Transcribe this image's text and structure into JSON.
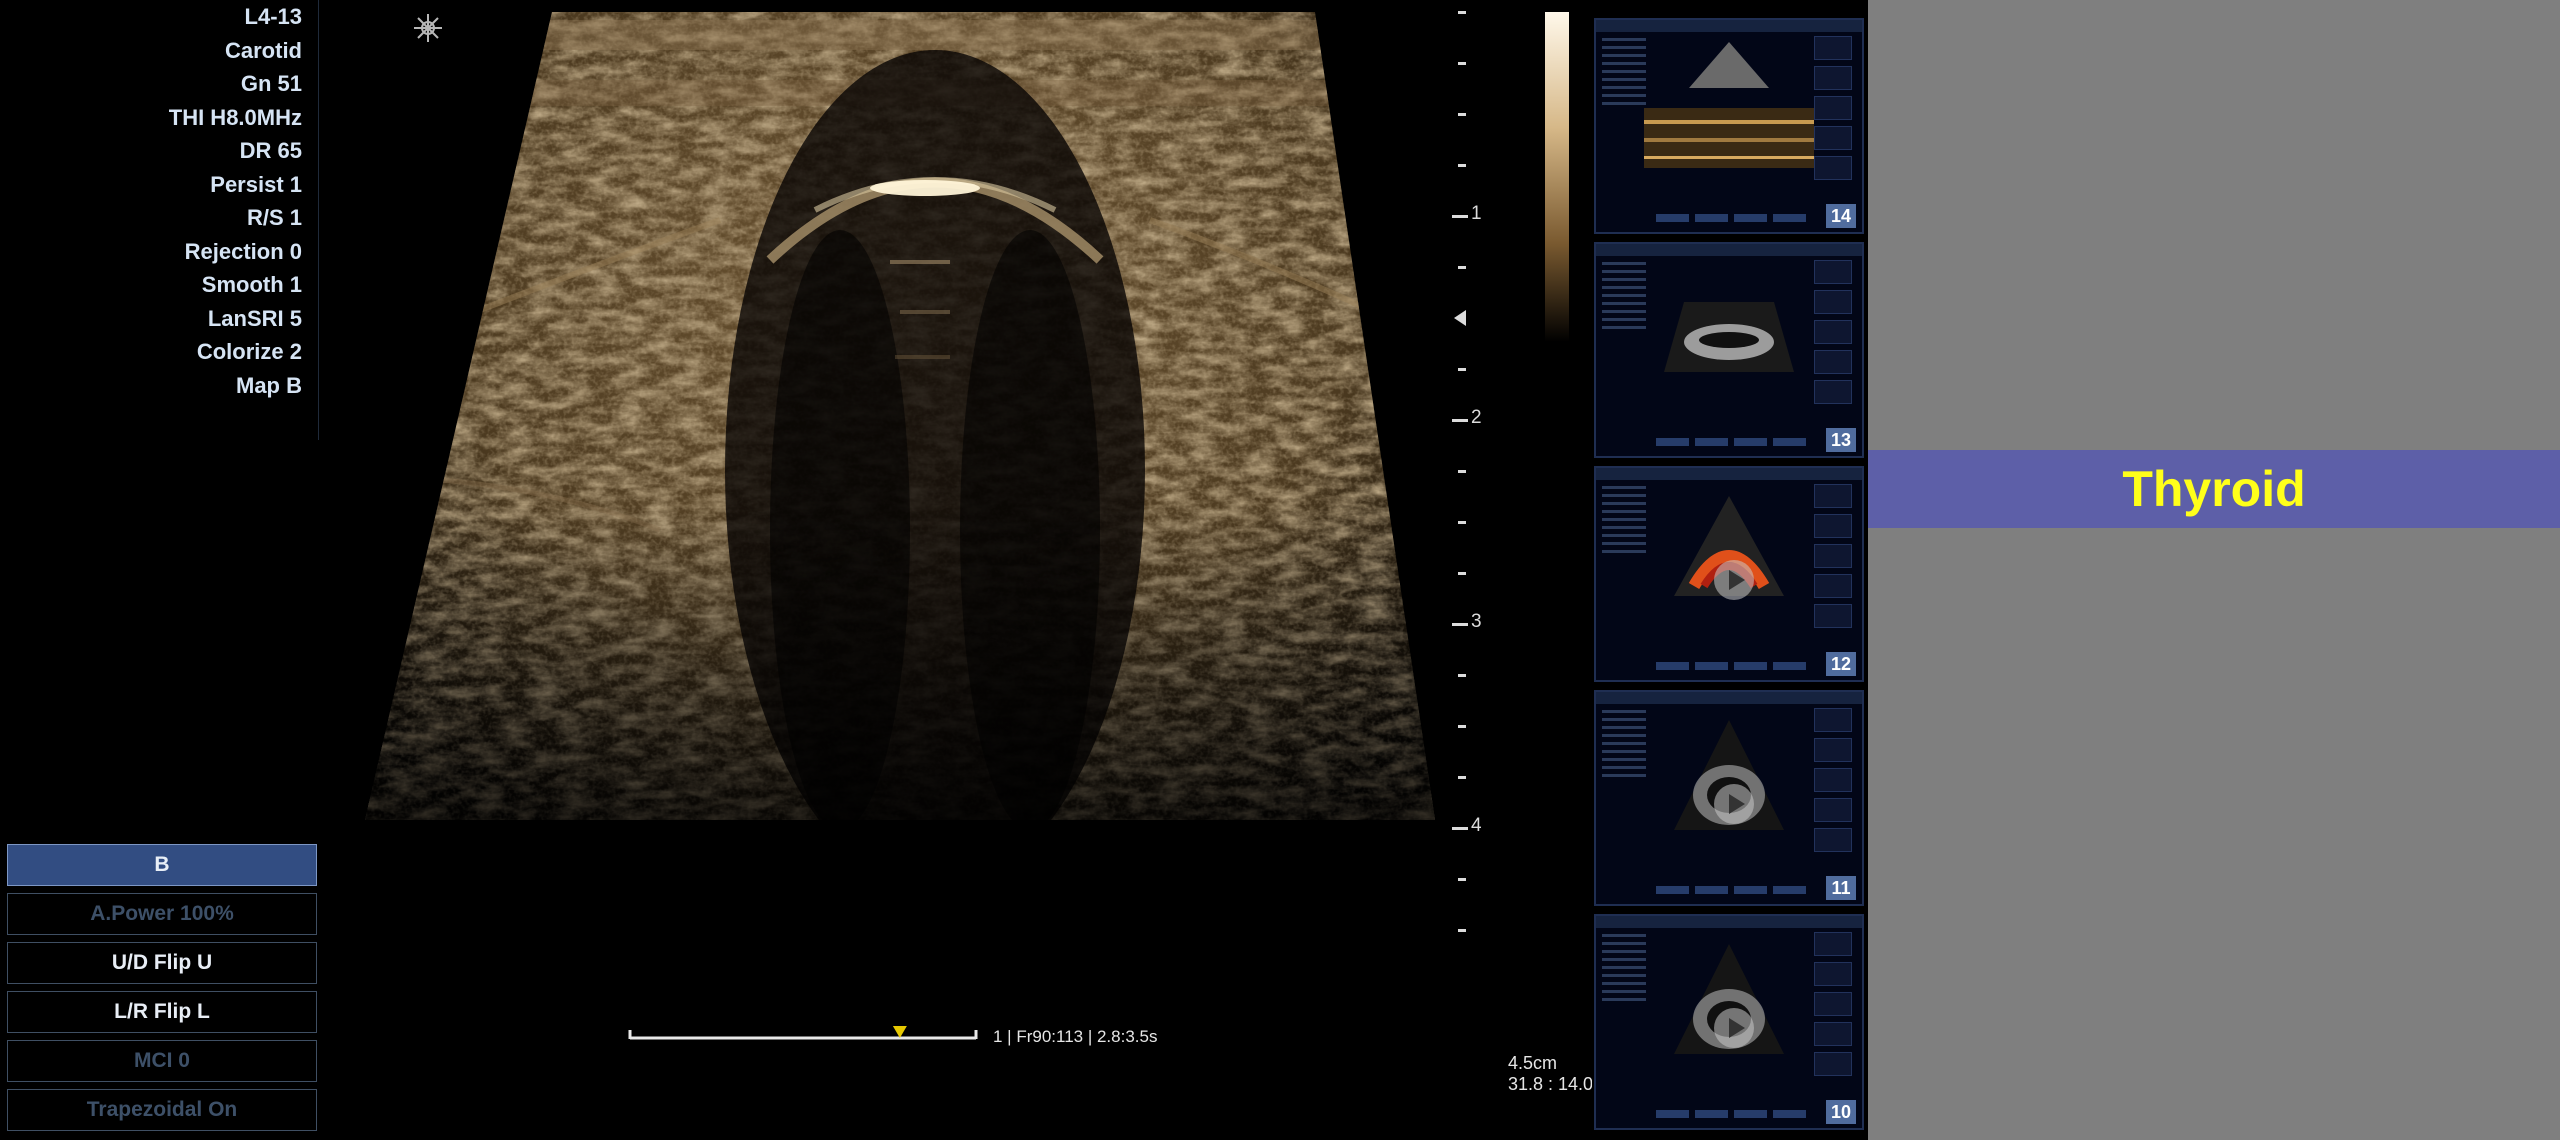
{
  "params": {
    "items": [
      "L4-13",
      "Carotid",
      "Gn 51",
      "THI H8.0MHz",
      "DR 65",
      "Persist 1",
      "R/S 1",
      "Rejection 0",
      "Smooth 1",
      "LanSRI 5",
      "Colorize 2",
      "Map B"
    ]
  },
  "mode_buttons": [
    {
      "label": "B",
      "state": "active"
    },
    {
      "label": "A.Power 100%",
      "state": "dim"
    },
    {
      "label": "U/D Flip  U",
      "state": "normal"
    },
    {
      "label": "L/R Flip  L",
      "state": "normal"
    },
    {
      "label": "MCI 0",
      "state": "dim"
    },
    {
      "label": "Trapezoidal  On",
      "state": "dim"
    }
  ],
  "depth_scale": {
    "labels": [
      "1",
      "2",
      "3",
      "4"
    ]
  },
  "cine": {
    "info": "1 | Fr90:113 | 2.8:3.5s",
    "position": 0.78
  },
  "readouts": {
    "depth": "4.5cm",
    "ratio": "31.8 : 14.0"
  },
  "thumbnails": [
    {
      "number": "14",
      "kind": "doppler",
      "play": false
    },
    {
      "number": "13",
      "kind": "plax",
      "play": false
    },
    {
      "number": "12",
      "kind": "color",
      "play": true
    },
    {
      "number": "11",
      "kind": "apical",
      "play": true
    },
    {
      "number": "10",
      "kind": "apical",
      "play": true
    }
  ],
  "banner": {
    "title": "Thyroid"
  },
  "colors": {
    "banner_bg": "#5d5fa8",
    "banner_text": "#ffff1a",
    "panel_bg": "#7f7f7f",
    "button_active": "#324d82",
    "cine_marker": "#e6c800"
  },
  "icons": {
    "probe_orientation": "probe-orientation-icon",
    "focus_marker": "focus-marker-icon",
    "play": "play-icon"
  }
}
